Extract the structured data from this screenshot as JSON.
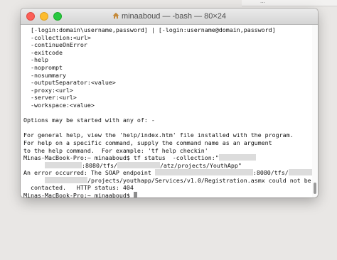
{
  "window": {
    "title": "minaaboud — -bash — 80×24",
    "home_icon": "home-folder-icon"
  },
  "background": {
    "strip_text": "..."
  },
  "terminal": {
    "lines": [
      {
        "parts": [
          {
            "t": "  [-login:domain\\username,password] | [-login:username@domain,password]"
          }
        ]
      },
      {
        "parts": [
          {
            "t": "  -collection:<url>"
          }
        ]
      },
      {
        "parts": [
          {
            "t": "  -continueOnError"
          }
        ]
      },
      {
        "parts": [
          {
            "t": "  -exitcode"
          }
        ]
      },
      {
        "parts": [
          {
            "t": "  -help"
          }
        ]
      },
      {
        "parts": [
          {
            "t": "  -noprompt"
          }
        ]
      },
      {
        "parts": [
          {
            "t": "  -nosummary"
          }
        ]
      },
      {
        "parts": [
          {
            "t": "  -outputSeparator:<value>"
          }
        ]
      },
      {
        "parts": [
          {
            "t": "  -proxy:<url>"
          }
        ]
      },
      {
        "parts": [
          {
            "t": "  -server:<url>"
          }
        ]
      },
      {
        "parts": [
          {
            "t": "  -workspace:<value>"
          }
        ]
      },
      {
        "parts": [
          {
            "t": ""
          }
        ]
      },
      {
        "parts": [
          {
            "t": "Options may be started with any of: -"
          }
        ]
      },
      {
        "parts": [
          {
            "t": ""
          }
        ]
      },
      {
        "parts": [
          {
            "t": "For general help, view the 'help/index.htm' file installed with the program."
          }
        ]
      },
      {
        "parts": [
          {
            "t": "For help on a specific command, supply the command name as an argument"
          }
        ]
      },
      {
        "parts": [
          {
            "t": "to the help command.  For example: 'tf help checkin'"
          }
        ]
      },
      {
        "parts": [
          {
            "t": "Minas-MacBook-Pro:~ minaaboud$ tf status  -collection:\""
          },
          {
            "r": 22
          }
        ]
      },
      {
        "parts": [
          {
            "t": "      "
          },
          {
            "r": 0
          },
          {
            "t": ":8080/tfs/"
          },
          {
            "r": 22
          },
          {
            "t": "/atz/projects/YouthApp\""
          }
        ]
      },
      {
        "parts": [
          {
            "t": "An error occurred: The SOAP endpoint "
          },
          {
            "r": 26
          },
          {
            "t": ":8080/tfs/"
          },
          {
            "r": 10
          }
        ]
      },
      {
        "parts": [
          {
            "t": "      "
          },
          {
            "r": 11
          },
          {
            "t": "/projects/youthapp/Services/v1.0/Registration.asmx could not be"
          }
        ]
      },
      {
        "parts": [
          {
            "t": "  contacted.   HTTP status: 404"
          }
        ]
      },
      {
        "parts": [
          {
            "t": "Minas-MacBook-Pro:~ minaaboud$ "
          },
          {
            "c": true
          }
        ]
      }
    ]
  }
}
